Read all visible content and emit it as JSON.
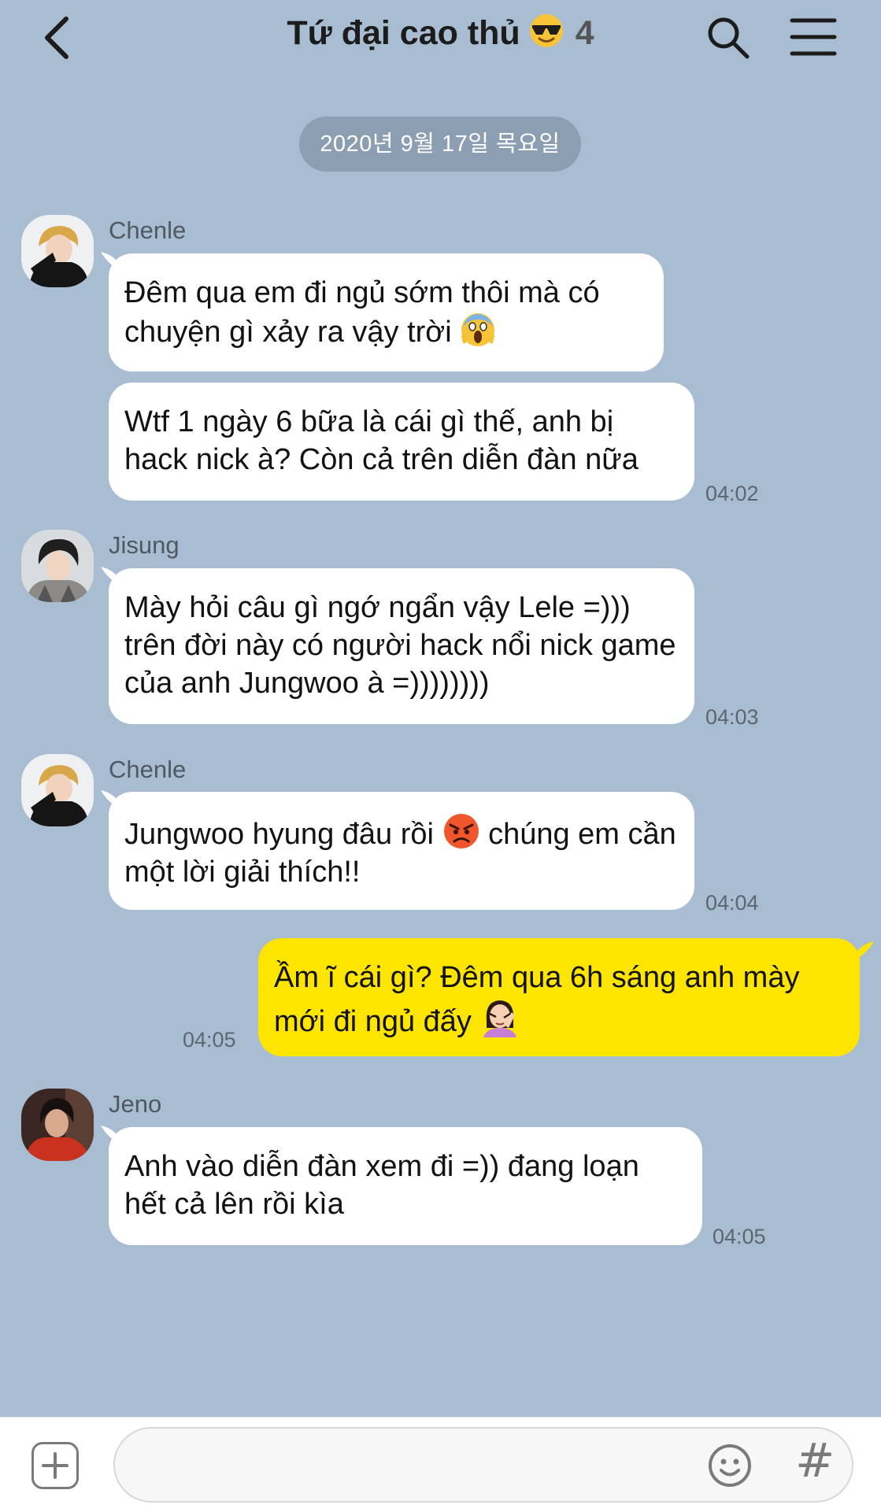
{
  "header": {
    "title": "Tứ đại cao thủ",
    "member_count": "4"
  },
  "date_divider": "2020년 9월 17일 목요일",
  "messages": [
    {
      "sender": "Chenle",
      "bubbles": [
        "Đêm qua em đi ngủ sớm thôi mà có chuyện gì xảy ra vậy trời",
        "Wtf 1 ngày 6 bữa là cái gì thế, anh bị hack nick à? Còn cả trên diễn đàn nữa"
      ],
      "time": "04:02"
    },
    {
      "sender": "Jisung",
      "bubbles": [
        "Mày hỏi câu gì ngớ ngẩn vậy Lele =))) trên đời này có người hack nổi nick game của anh Jungwoo à =))))))))"
      ],
      "time": "04:03"
    },
    {
      "sender": "Chenle",
      "bubbles": [
        "Jungwoo hyung đâu rồi",
        "chúng em cần một lời giải thích!!"
      ],
      "time": "04:04"
    },
    {
      "sender": "me",
      "bubbles": [
        "Ầm ĩ cái gì? Đêm qua 6h sáng anh mày mới đi ngủ đấy"
      ],
      "time": "04:05"
    },
    {
      "sender": "Jeno",
      "bubbles": [
        "Anh vào diễn đàn xem đi =)) đang loạn hết cả lên rồi kìa"
      ],
      "time": "04:05"
    }
  ],
  "composer": {
    "placeholder": ""
  },
  "icons": [
    "back-icon",
    "sunglasses-emoji-icon",
    "search-icon",
    "menu-icon",
    "screaming-emoji-icon",
    "angry-emoji-icon",
    "facepalm-emoji-icon",
    "plus-icon",
    "emoticon-icon",
    "hashtag-icon"
  ]
}
